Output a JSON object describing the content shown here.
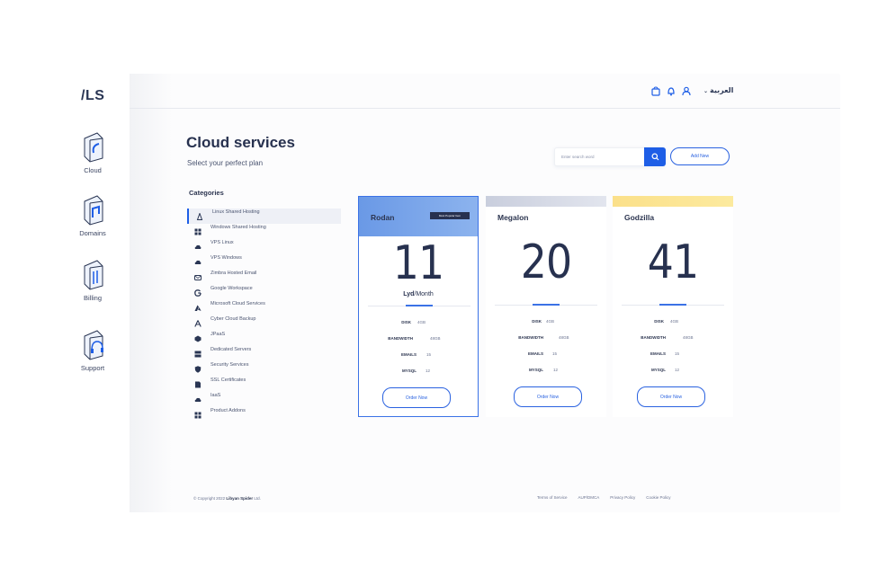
{
  "logo": "/LS",
  "nav": [
    {
      "label": "Cloud",
      "icon": "cloud-icon"
    },
    {
      "label": "Domains",
      "icon": "domains-icon"
    },
    {
      "label": "Billing",
      "icon": "billing-icon"
    },
    {
      "label": "Support",
      "icon": "support-icon"
    }
  ],
  "topbar": {
    "language": "العربية",
    "icons": [
      "cart-icon",
      "bell-icon",
      "user-icon"
    ]
  },
  "header": {
    "title": "Cloud services",
    "subtitle": "Select your perfect plan",
    "search_placeholder": "Enter search word",
    "add_label": "Add New"
  },
  "categories": {
    "title": "Categories",
    "items": [
      {
        "label": "Linux Shared Hosting",
        "icon": "linux-icon",
        "active": true
      },
      {
        "label": "Windows Shared Hosting",
        "icon": "windows-icon"
      },
      {
        "label": "VPS Linux",
        "icon": "cloud-icon"
      },
      {
        "label": "VPS Windows",
        "icon": "cloud-icon"
      },
      {
        "label": "Zimbra Hosted Email",
        "icon": "email-icon"
      },
      {
        "label": "Google Workspace",
        "icon": "google-icon"
      },
      {
        "label": "Microsoft Cloud Services",
        "icon": "azure-icon"
      },
      {
        "label": "Cyber Cloud Backup",
        "icon": "azure-icon"
      },
      {
        "label": "JPaaS",
        "icon": "jpaas-icon"
      },
      {
        "label": "Dedicated Servers",
        "icon": "server-icon"
      },
      {
        "label": "Security Services",
        "icon": "shield-icon"
      },
      {
        "label": "SSL Certificates",
        "icon": "certificate-icon"
      },
      {
        "label": "IaaS",
        "icon": "cloud-icon"
      },
      {
        "label": "Product Addons",
        "icon": "addons-icon"
      }
    ]
  },
  "plans": [
    {
      "name": "Rodan",
      "badge": "Most Popular Item",
      "price": "11",
      "currency": "Lyd",
      "period": "/Month",
      "featured": true,
      "band_color": "#7ba5ea",
      "specs": [
        {
          "key": "DISK",
          "value": "4GB"
        },
        {
          "key": "BANDWIDTH",
          "value": "48GB"
        },
        {
          "key": "EMAILS",
          "value": "15"
        },
        {
          "key": "MYSQL",
          "value": "12"
        }
      ],
      "order_label": "Order Now"
    },
    {
      "name": "Megalon",
      "price": "20",
      "featured": false,
      "band_color": "#d3d7e3",
      "specs": [
        {
          "key": "DISK",
          "value": "4GB"
        },
        {
          "key": "BANDWIDTH",
          "value": "48GB"
        },
        {
          "key": "EMAILS",
          "value": "15"
        },
        {
          "key": "MYSQL",
          "value": "12"
        }
      ],
      "order_label": "Order Now"
    },
    {
      "name": "Godzilla",
      "price": "41",
      "featured": false,
      "band_color": "#fbe48e",
      "specs": [
        {
          "key": "DISK",
          "value": "4GB"
        },
        {
          "key": "BANDWIDTH",
          "value": "48GB"
        },
        {
          "key": "EMAILS",
          "value": "15"
        },
        {
          "key": "MYSQL",
          "value": "12"
        }
      ],
      "order_label": "Order Now"
    }
  ],
  "footer": {
    "copyright": "© Copyright 2022",
    "company": "Libyan Spider",
    "suffix": "Ltd.",
    "links": [
      "Terms of Service",
      "AUP/DMCA",
      "Privacy Policy",
      "Cookie Policy"
    ]
  },
  "colors": {
    "accent": "#1e5ee6",
    "text": "#27314f"
  }
}
